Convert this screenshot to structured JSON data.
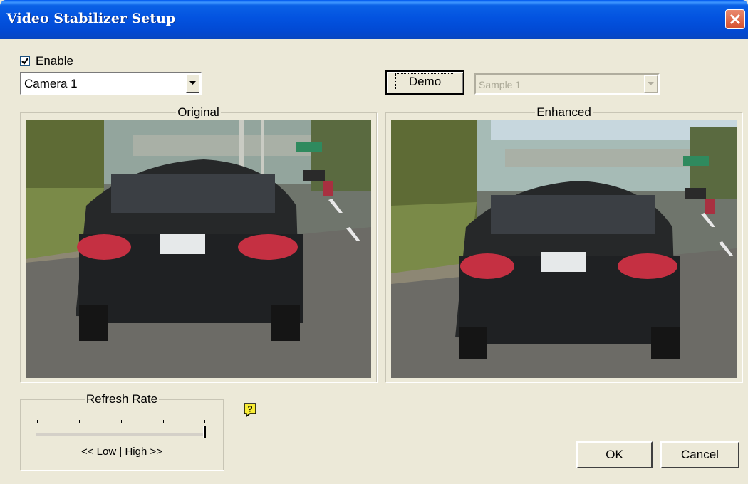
{
  "window": {
    "title": "Video Stabilizer Setup"
  },
  "enable": {
    "label": "Enable",
    "checked": true
  },
  "camera_select": {
    "value": "Camera 1"
  },
  "demo_button": {
    "label": "Demo"
  },
  "sample_select": {
    "value": "Sample 1",
    "disabled": true
  },
  "original_panel": {
    "label": "Original"
  },
  "enhanced_panel": {
    "label": "Enhanced"
  },
  "refresh_rate": {
    "label": "Refresh Rate",
    "low_label": "<< Low",
    "separator": "|",
    "high_label": "High >>",
    "value_fraction": 1.0
  },
  "help": {
    "icon": "question-help-icon"
  },
  "footer": {
    "ok_label": "OK",
    "cancel_label": "Cancel"
  },
  "colors": {
    "titlebar": "#0353e0",
    "dialog_bg": "#ece9d8",
    "close": "#d6502e"
  }
}
